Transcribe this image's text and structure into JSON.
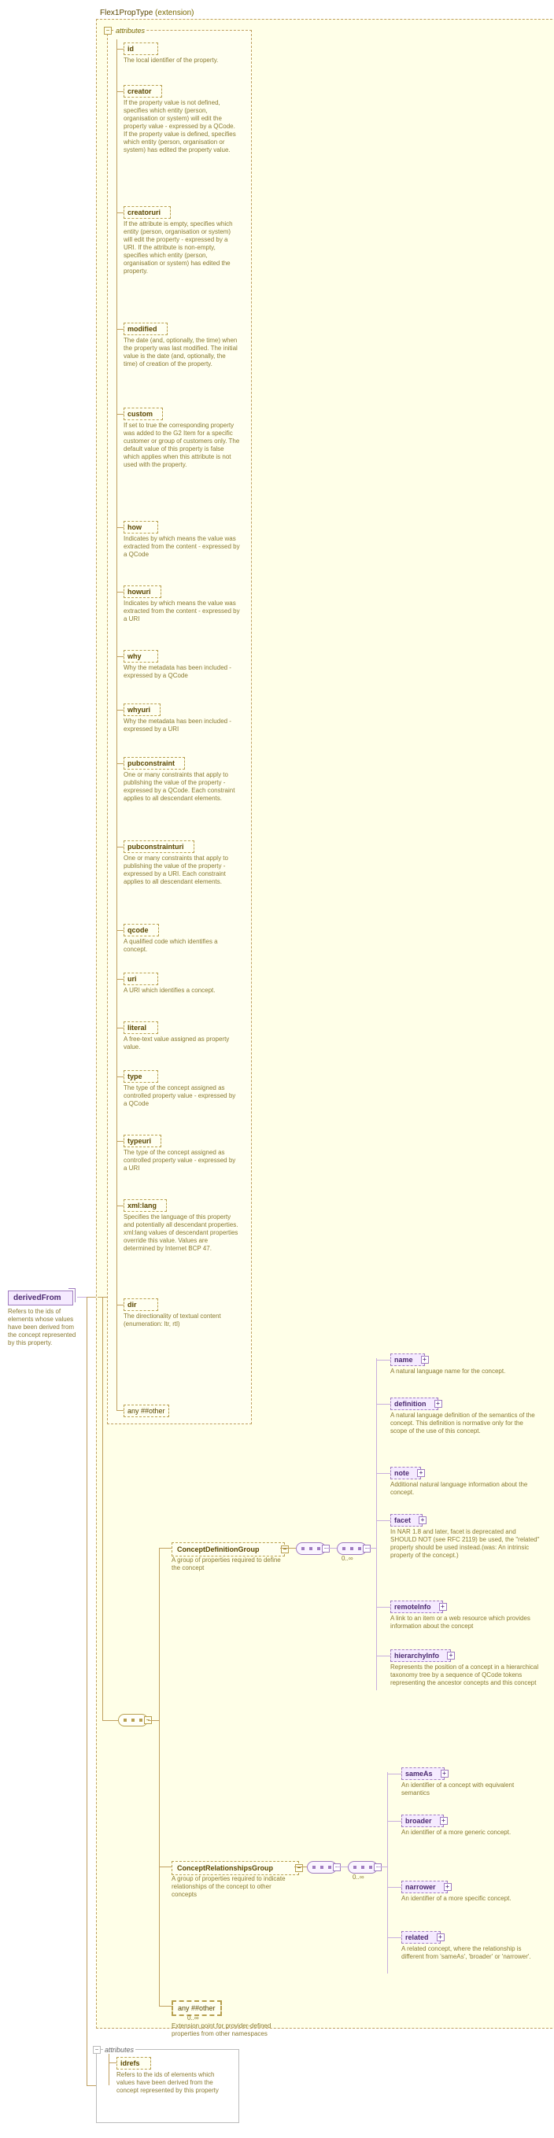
{
  "ext_label_name": "Flex1PropType",
  "ext_label_tag": "(extension)",
  "root": {
    "name": "derivedFrom",
    "desc": "Refers to the ids of elements whose values have been derived from the concept represented by this property."
  },
  "attrs1_title": "attributes",
  "attrs1": [
    {
      "name": "id",
      "desc": "The local identifier of the property."
    },
    {
      "name": "creator",
      "desc": "If the property value is not defined, specifies which entity (person, organisation or system) will edit the property value - expressed by a QCode. If the property value is defined, specifies which entity (person, organisation or system) has edited the property value."
    },
    {
      "name": "creatoruri",
      "desc": "If the attribute is empty, specifies which entity (person, organisation or system) will edit the property - expressed by a URI. If the attribute is non-empty, specifies which entity (person, organisation or system) has edited the property."
    },
    {
      "name": "modified",
      "desc": "The date (and, optionally, the time) when the property was last modified. The initial value is the date (and, optionally, the time) of creation of the property."
    },
    {
      "name": "custom",
      "desc": "If set to true the corresponding property was added to the G2 Item for a specific customer or group of customers only. The default value of this property is false which applies when this attribute is not used with the property."
    },
    {
      "name": "how",
      "desc": "Indicates by which means the value was extracted from the content - expressed by a QCode"
    },
    {
      "name": "howuri",
      "desc": "Indicates by which means the value was extracted from the content - expressed by a URI"
    },
    {
      "name": "why",
      "desc": "Why the metadata has been included - expressed by a QCode"
    },
    {
      "name": "whyuri",
      "desc": "Why the metadata has been included - expressed by a URI"
    },
    {
      "name": "pubconstraint",
      "desc": "One or many constraints that apply to publishing the value of the property - expressed by a QCode. Each constraint applies to all descendant elements."
    },
    {
      "name": "pubconstrainturi",
      "desc": "One or many constraints that apply to publishing the value of the property - expressed by a URI. Each constraint applies to all descendant elements."
    },
    {
      "name": "qcode",
      "desc": "A qualified code which identifies a concept."
    },
    {
      "name": "uri",
      "desc": "A URI which identifies a concept."
    },
    {
      "name": "literal",
      "desc": "A free-text value assigned as property value."
    },
    {
      "name": "type",
      "desc": "The type of the concept assigned as controlled property value - expressed by a QCode"
    },
    {
      "name": "typeuri",
      "desc": "The type of the concept assigned as controlled property value - expressed by a URI"
    },
    {
      "name": "xml:lang",
      "desc": "Specifies the language of this property and potentially all descendant properties. xml:lang values of descendant properties override this value. Values are determined by Internet BCP 47."
    },
    {
      "name": "dir",
      "desc": "The directionality of textual content (enumeration: ltr, rtl)"
    }
  ],
  "any_other": "any ##other",
  "groups": {
    "def": {
      "name": "ConceptDefinitionGroup",
      "desc": "A group of properties required to define the concept"
    },
    "rel": {
      "name": "ConceptRelationshipsGroup",
      "desc": "A group of properties required to indicate relationships of the concept to other concepts"
    }
  },
  "def_items": [
    {
      "name": "name",
      "desc": "A natural language name for the concept."
    },
    {
      "name": "definition",
      "desc": "A natural language definition of the semantics of the concept. This definition is normative only for the scope of the use of this concept."
    },
    {
      "name": "note",
      "desc": "Additional natural language information about the concept."
    },
    {
      "name": "facet",
      "desc": "In NAR 1.8 and later, facet is deprecated and SHOULD NOT (see RFC 2119) be used, the \"related\" property should be used instead.(was: An intrinsic property of the concept.)"
    },
    {
      "name": "remoteInfo",
      "desc": "A link to an item or a web resource which provides information about the concept"
    },
    {
      "name": "hierarchyInfo",
      "desc": "Represents the position of a concept in a hierarchical taxonomy tree by a sequence of QCode tokens representing the ancestor concepts and this concept"
    }
  ],
  "rel_items": [
    {
      "name": "sameAs",
      "desc": "An identifier of a concept with equivalent semantics"
    },
    {
      "name": "broader",
      "desc": "An identifier of a more generic concept."
    },
    {
      "name": "narrower",
      "desc": "An identifier of a more specific concept."
    },
    {
      "name": "related",
      "desc": "A related concept, where the relationship is different from 'sameAs', 'broader' or 'narrower'."
    }
  ],
  "seq_any": {
    "label": "any ##other",
    "occ": "0..∞",
    "desc": "Extension point for provider-defined properties from other namespaces"
  },
  "occ_label": "0..∞",
  "attrs2_title": "attributes",
  "attrs2": {
    "name": "idrefs",
    "desc": "Refers to the ids of elements which values have been derived from the concept represented by this property"
  }
}
